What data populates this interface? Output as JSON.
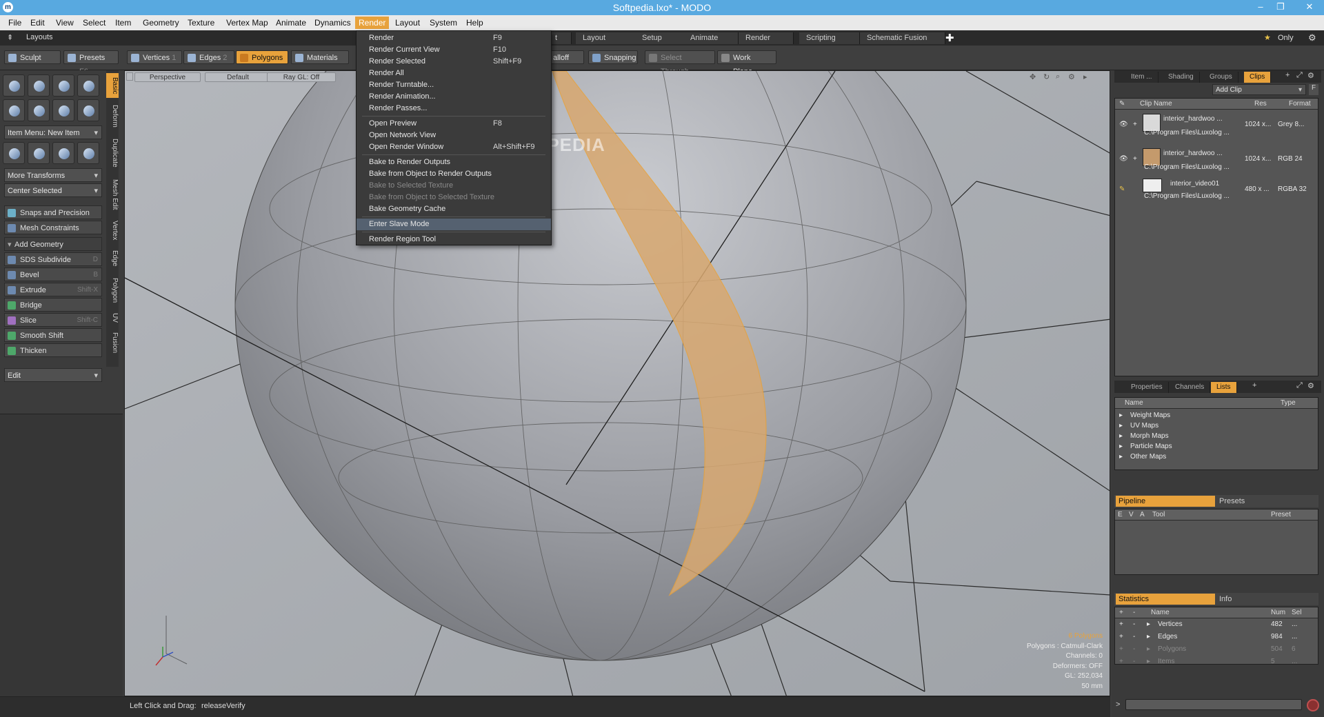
{
  "window": {
    "title": "Softpedia.lxo* - MODO",
    "logo": "m",
    "min": "–",
    "max": "❐",
    "close": "✕"
  },
  "menubar": [
    "File",
    "Edit",
    "View",
    "Select",
    "Item",
    "Geometry",
    "Texture",
    "Vertex Map",
    "Animate",
    "Dynamics",
    "Render",
    "Layout",
    "System",
    "Help"
  ],
  "layouts_label": "Layouts",
  "layout_tabs": [
    "t",
    "Layout",
    "Setup",
    "Animate",
    "Render",
    "Scripting",
    "Schematic Fusion"
  ],
  "only_label": "Only",
  "toolbar": {
    "sculpt": "Sculpt",
    "presets": "Presets",
    "presets_key": "F6",
    "vertices": "Vertices",
    "vertices_key": "1",
    "edges": "Edges",
    "edges_key": "2",
    "polygons": "Polygons",
    "materials": "Materials",
    "falloff": "alloff",
    "snapping": "Snapping",
    "select_through": "Select Through",
    "work_plane": "Work Plane"
  },
  "left": {
    "item_menu": "Item Menu: New Item",
    "more_transforms": "More Transforms",
    "center_selected": "Center Selected",
    "snaps": "Snaps and Precision",
    "mesh_constraints": "Mesh Constraints",
    "add_geometry": "Add Geometry",
    "tools": [
      {
        "label": "SDS Subdivide",
        "key": "D"
      },
      {
        "label": "Bevel",
        "key": "B"
      },
      {
        "label": "Extrude",
        "key": "Shift-X"
      },
      {
        "label": "Bridge",
        "key": ""
      },
      {
        "label": "Slice",
        "key": "Shift-C"
      },
      {
        "label": "Smooth Shift",
        "key": ""
      },
      {
        "label": "Thicken",
        "key": ""
      }
    ],
    "edit_dropdown": "Edit",
    "vtabs": [
      "Basic",
      "Deform",
      "Duplicate",
      "Mesh Edit",
      "Vertex",
      "Edge",
      "Polygon",
      "UV",
      "Fusion"
    ]
  },
  "viewport": {
    "view": "Perspective",
    "shading": "Default",
    "raygl": "Ray GL: Off",
    "stats": [
      "6 Polygons",
      "Polygons : Catmull-Clark",
      "Channels: 0",
      "Deformers: OFF",
      "GL: 252,034",
      "50 mm"
    ]
  },
  "watermark": "SOFTPEDIA",
  "render_menu": {
    "items": [
      {
        "label": "Render",
        "key": "F9"
      },
      {
        "label": "Render Current View",
        "key": "F10"
      },
      {
        "label": "Render Selected",
        "key": "Shift+F9"
      },
      {
        "label": "Render All",
        "key": ""
      },
      {
        "label": "Render Turntable...",
        "key": ""
      },
      {
        "label": "Render Animation...",
        "key": ""
      },
      {
        "label": "Render Passes...",
        "key": ""
      },
      {
        "label": "Open Preview",
        "key": "F8"
      },
      {
        "label": "Open Network View",
        "key": ""
      },
      {
        "label": "Open Render Window",
        "key": "Alt+Shift+F9"
      },
      {
        "label": "Bake to Render Outputs",
        "key": ""
      },
      {
        "label": "Bake from Object to Render Outputs",
        "key": ""
      },
      {
        "label": "Bake to Selected Texture",
        "key": ""
      },
      {
        "label": "Bake from Object to Selected Texture",
        "key": ""
      },
      {
        "label": "Bake Geometry Cache",
        "key": ""
      },
      {
        "label": "Enter Slave Mode",
        "key": ""
      },
      {
        "label": "Render Region Tool",
        "key": ""
      }
    ]
  },
  "right": {
    "top_tabs": [
      "Item ...",
      "Shading",
      "Groups",
      "Clips"
    ],
    "add_clip": "Add Clip",
    "clips_header": {
      "name": "Clip Name",
      "res": "Res",
      "format": "Format"
    },
    "clips": [
      {
        "name": "interior_hardwoo ...",
        "path": "C:\\Program Files\\Luxolog ...",
        "res": "1024 x...",
        "format": "Grey 8..."
      },
      {
        "name": "interior_hardwoo ...",
        "path": "C:\\Program Files\\Luxolog ...",
        "res": "1024 x...",
        "format": "RGB 24"
      },
      {
        "name": "interior_video01",
        "path": "C:\\Program Files\\Luxolog ...",
        "res": "480 x ...",
        "format": "RGBA 32"
      }
    ],
    "mid_tabs": [
      "Properties",
      "Channels",
      "Lists"
    ],
    "lists_header": {
      "name": "Name",
      "type": "Type"
    },
    "lists": [
      "Weight Maps",
      "UV Maps",
      "Morph Maps",
      "Particle Maps",
      "Other Maps"
    ],
    "pipeline": "Pipeline",
    "presets": "Presets",
    "pipeline_header": {
      "e": "E",
      "v": "V",
      "a": "A",
      "tool": "Tool",
      "preset": "Preset"
    },
    "statistics": "Statistics",
    "info": "Info",
    "stats_header": {
      "name": "Name",
      "num": "Num",
      "sel": "Sel"
    },
    "stats": [
      {
        "name": "Vertices",
        "num": "482",
        "sel": "..."
      },
      {
        "name": "Edges",
        "num": "984",
        "sel": "..."
      },
      {
        "name": "Polygons",
        "num": "504",
        "sel": "6"
      },
      {
        "name": "Items",
        "num": "5",
        "sel": "..."
      }
    ]
  },
  "status": {
    "label": "Left Click and Drag:",
    "value": "releaseVerify",
    "prompt": ">"
  }
}
